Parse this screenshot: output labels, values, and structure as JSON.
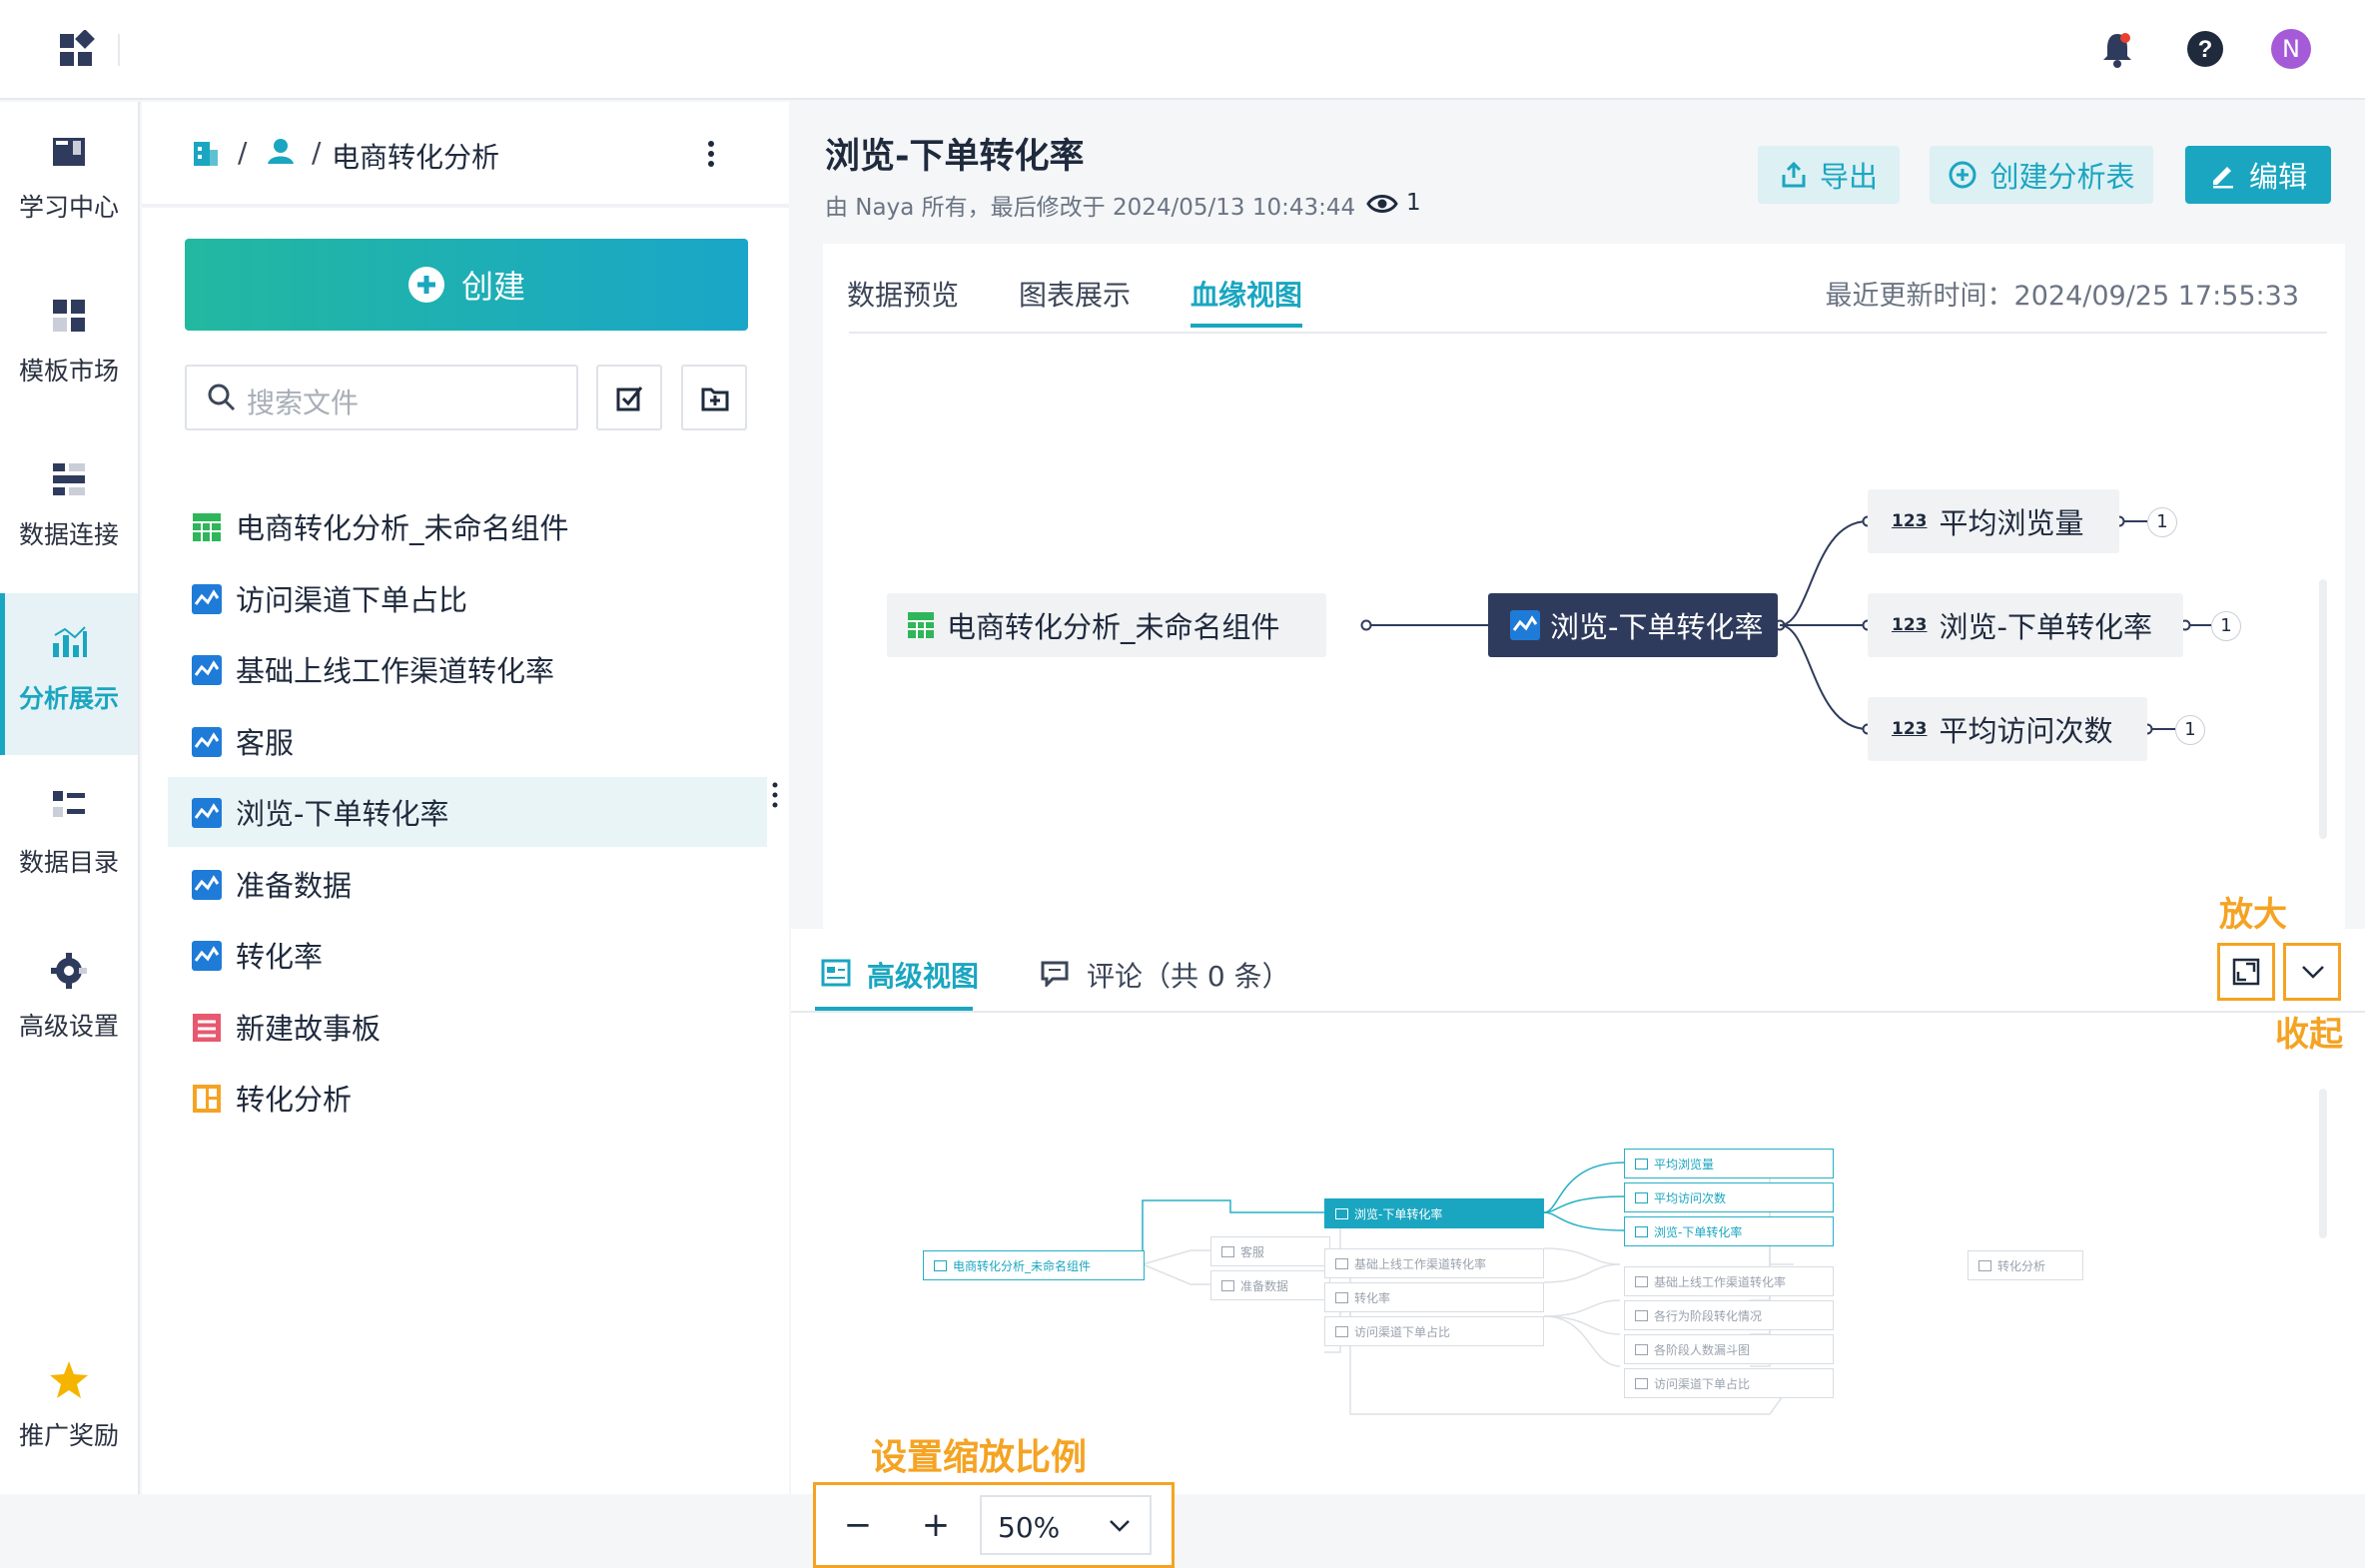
{
  "topbar": {
    "avatar_letter": "N"
  },
  "nav": {
    "items": [
      {
        "label": "学习中心",
        "icon": "book-icon"
      },
      {
        "label": "模板市场",
        "icon": "template-icon"
      },
      {
        "label": "数据连接",
        "icon": "data-connect-icon"
      },
      {
        "label": "分析展示",
        "icon": "analysis-icon",
        "active": true
      },
      {
        "label": "数据目录",
        "icon": "catalog-icon"
      },
      {
        "label": "高级设置",
        "icon": "settings-icon"
      }
    ],
    "promo_label": "推广奖励"
  },
  "filepanel": {
    "breadcrumb_sep": "/",
    "breadcrumb_title": "电商转化分析",
    "create_label": "创建",
    "search_placeholder": "搜索文件",
    "files": [
      {
        "name": "电商转化分析_未命名组件",
        "type": "table",
        "color": "#2fb65a"
      },
      {
        "name": "访问渠道下单占比",
        "type": "chart",
        "color": "#1f7bd8"
      },
      {
        "name": "基础上线工作渠道转化率",
        "type": "chart",
        "color": "#1f7bd8"
      },
      {
        "name": "客服",
        "type": "chart",
        "color": "#1f7bd8"
      },
      {
        "name": "浏览-下单转化率",
        "type": "chart",
        "color": "#1f7bd8",
        "selected": true
      },
      {
        "name": "准备数据",
        "type": "chart",
        "color": "#1f7bd8"
      },
      {
        "name": "转化率",
        "type": "chart",
        "color": "#1f7bd8"
      },
      {
        "name": "新建故事板",
        "type": "story",
        "color": "#e8586f"
      },
      {
        "name": "转化分析",
        "type": "dashboard",
        "color": "#f5a323"
      }
    ]
  },
  "header": {
    "title": "浏览-下单转化率",
    "meta": "由 Naya 所有，最后修改于 2024/05/13 10:43:44",
    "view_count": "1",
    "export_label": "导出",
    "create_table_label": "创建分析表",
    "edit_label": "编辑"
  },
  "tabs": {
    "items": [
      "数据预览",
      "图表展示",
      "血缘视图"
    ],
    "active_index": 2,
    "last_update": "最近更新时间：2024/09/25 17:55:33"
  },
  "lineage": {
    "source": "电商转化分析_未命名组件",
    "center": "浏览-下单转化率",
    "outputs": [
      {
        "label": "平均浏览量",
        "count": "1"
      },
      {
        "label": "浏览-下单转化率",
        "count": "1"
      },
      {
        "label": "平均访问次数",
        "count": "1"
      }
    ]
  },
  "bottom": {
    "tab_advanced": "高级视图",
    "tab_comments": "评论（共 0 条）",
    "annot_zoom_in": "放大",
    "annot_collapse": "收起",
    "annot_zoom_setting": "设置缩放比例",
    "zoom_value": "50%",
    "minus": "−",
    "plus": "+"
  },
  "minimap": {
    "source": "电商转化分析_未命名组件",
    "col2": [
      "客服",
      "准备数据"
    ],
    "col3": [
      "浏览-下单转化率",
      "基础上线工作渠道转化率",
      "转化率",
      "访问渠道下单占比"
    ],
    "col4": [
      "平均浏览量",
      "平均访问次数",
      "浏览-下单转化率",
      "基础上线工作渠道转化率",
      "各行为阶段转化情况",
      "各阶段人数漏斗图",
      "访问渠道下单占比"
    ],
    "end": "转化分析"
  },
  "colors": {
    "accent": "#1aa6c0",
    "dark_node": "#2f3b5c",
    "annotation": "#f5a323"
  }
}
